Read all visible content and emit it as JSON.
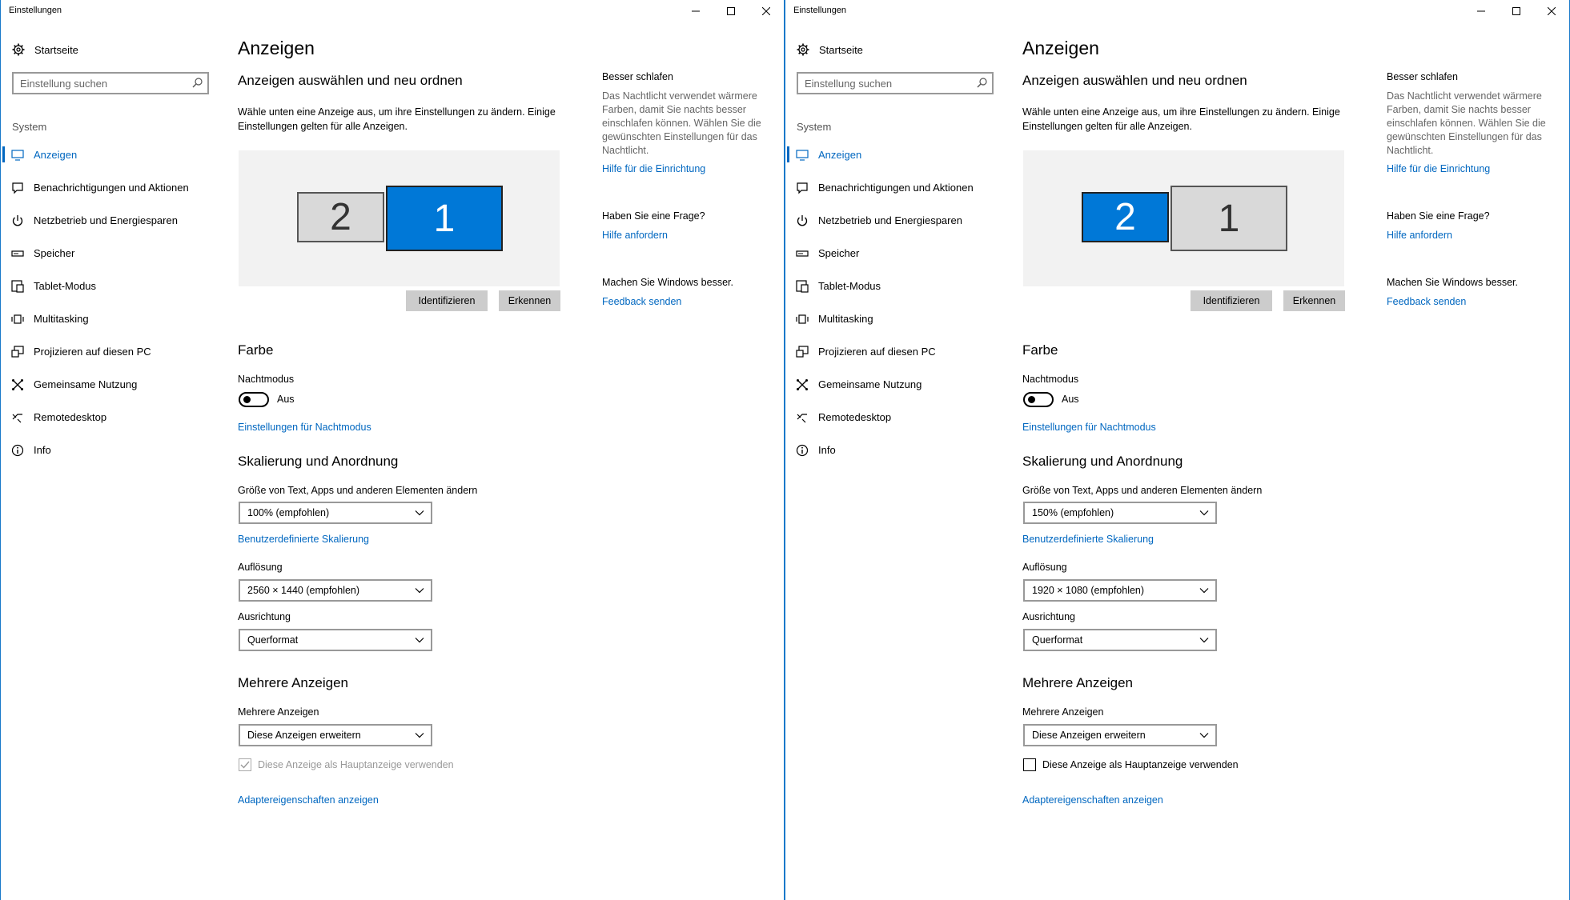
{
  "windows": [
    {
      "id": "left",
      "title": "Einstellungen",
      "nav": {
        "home_label": "Startseite",
        "search_placeholder": "Einstellung suchen",
        "category": "System",
        "items": [
          {
            "label": "Anzeigen",
            "icon": "monitor-icon",
            "selected": true
          },
          {
            "label": "Benachrichtigungen und Aktionen",
            "icon": "notification-icon"
          },
          {
            "label": "Netzbetrieb und Energiesparen",
            "icon": "power-icon"
          },
          {
            "label": "Speicher",
            "icon": "storage-icon"
          },
          {
            "label": "Tablet-Modus",
            "icon": "tablet-icon"
          },
          {
            "label": "Multitasking",
            "icon": "multitasking-icon"
          },
          {
            "label": "Projizieren auf diesen PC",
            "icon": "project-icon"
          },
          {
            "label": "Gemeinsame Nutzung",
            "icon": "share-icon"
          },
          {
            "label": "Remotedesktop",
            "icon": "remote-icon"
          },
          {
            "label": "Info",
            "icon": "info-icon"
          }
        ]
      },
      "content": {
        "page_title": "Anzeigen",
        "arrange_heading": "Anzeigen auswählen und neu ordnen",
        "arrange_desc_1": "Wähle unten eine Anzeige aus, um ihre Einstellungen zu ändern. Einige",
        "arrange_desc_2": "Einstellungen gelten für alle Anzeigen.",
        "monitor_secondary": "2",
        "monitor_primary": "1",
        "selected_monitor": "1",
        "identify_button": "Identifizieren",
        "detect_button": "Erkennen",
        "color_heading": "Farbe",
        "night_label": "Nachtmodus",
        "night_state": "Aus",
        "night_settings_link": "Einstellungen für Nachtmodus",
        "scale_heading": "Skalierung und Anordnung",
        "size_label": "Größe von Text, Apps und anderen Elementen ändern",
        "size_value": "100% (empfohlen)",
        "custom_scaling_link": "Benutzerdefinierte Skalierung",
        "resolution_label": "Auflösung",
        "resolution_value": "2560 × 1440 (empfohlen)",
        "orientation_label": "Ausrichtung",
        "orientation_value": "Querformat",
        "multi_heading": "Mehrere Anzeigen",
        "multi_label": "Mehrere Anzeigen",
        "multi_value": "Diese Anzeigen erweitern",
        "main_display_label": "Diese Anzeige als Hauptanzeige verwenden",
        "main_display_checked": true,
        "main_display_disabled": true,
        "adapter_link": "Adaptereigenschaften anzeigen"
      },
      "side": {
        "sleep_title": "Besser schlafen",
        "sleep_desc_1": "Das Nachtlicht verwendet wärmere",
        "sleep_desc_2": "Farben, damit Sie nachts besser",
        "sleep_desc_3": "einschlafen können. Wählen Sie die",
        "sleep_desc_4": "gewünschten Einstellungen für das",
        "sleep_desc_5": "Nachtlicht.",
        "sleep_link": "Hilfe für die Einrichtung",
        "question_title": "Haben Sie eine Frage?",
        "question_link": "Hilfe anfordern",
        "improve_title": "Machen Sie Windows besser.",
        "improve_link": "Feedback senden"
      }
    },
    {
      "id": "right",
      "title": "Einstellungen",
      "nav": {
        "home_label": "Startseite",
        "search_placeholder": "Einstellung suchen",
        "category": "System",
        "items": [
          {
            "label": "Anzeigen",
            "icon": "monitor-icon",
            "selected": true
          },
          {
            "label": "Benachrichtigungen und Aktionen",
            "icon": "notification-icon"
          },
          {
            "label": "Netzbetrieb und Energiesparen",
            "icon": "power-icon"
          },
          {
            "label": "Speicher",
            "icon": "storage-icon"
          },
          {
            "label": "Tablet-Modus",
            "icon": "tablet-icon"
          },
          {
            "label": "Multitasking",
            "icon": "multitasking-icon"
          },
          {
            "label": "Projizieren auf diesen PC",
            "icon": "project-icon"
          },
          {
            "label": "Gemeinsame Nutzung",
            "icon": "share-icon"
          },
          {
            "label": "Remotedesktop",
            "icon": "remote-icon"
          },
          {
            "label": "Info",
            "icon": "info-icon"
          }
        ]
      },
      "content": {
        "page_title": "Anzeigen",
        "arrange_heading": "Anzeigen auswählen und neu ordnen",
        "arrange_desc_1": "Wähle unten eine Anzeige aus, um ihre Einstellungen zu ändern. Einige",
        "arrange_desc_2": "Einstellungen gelten für alle Anzeigen.",
        "monitor_secondary": "2",
        "monitor_primary": "1",
        "selected_monitor": "2",
        "identify_button": "Identifizieren",
        "detect_button": "Erkennen",
        "color_heading": "Farbe",
        "night_label": "Nachtmodus",
        "night_state": "Aus",
        "night_settings_link": "Einstellungen für Nachtmodus",
        "scale_heading": "Skalierung und Anordnung",
        "size_label": "Größe von Text, Apps und anderen Elementen ändern",
        "size_value": "150% (empfohlen)",
        "custom_scaling_link": "Benutzerdefinierte Skalierung",
        "resolution_label": "Auflösung",
        "resolution_value": "1920 × 1080 (empfohlen)",
        "orientation_label": "Ausrichtung",
        "orientation_value": "Querformat",
        "multi_heading": "Mehrere Anzeigen",
        "multi_label": "Mehrere Anzeigen",
        "multi_value": "Diese Anzeigen erweitern",
        "main_display_label": "Diese Anzeige als Hauptanzeige verwenden",
        "main_display_checked": false,
        "main_display_disabled": false,
        "adapter_link": "Adaptereigenschaften anzeigen"
      },
      "side": {
        "sleep_title": "Besser schlafen",
        "sleep_desc_1": "Das Nachtlicht verwendet wärmere",
        "sleep_desc_2": "Farben, damit Sie nachts besser",
        "sleep_desc_3": "einschlafen können. Wählen Sie die",
        "sleep_desc_4": "gewünschten Einstellungen für das",
        "sleep_desc_5": "Nachtlicht.",
        "sleep_link": "Hilfe für die Einrichtung",
        "question_title": "Haben Sie eine Frage?",
        "question_link": "Hilfe anfordern",
        "improve_title": "Machen Sie Windows besser.",
        "improve_link": "Feedback senden"
      }
    }
  ],
  "colors": {
    "accent": "#0067c0",
    "monitor_selected": "#0078d7",
    "monitor_unselected": "#d9d9d9",
    "window_border": "#1979ca"
  }
}
